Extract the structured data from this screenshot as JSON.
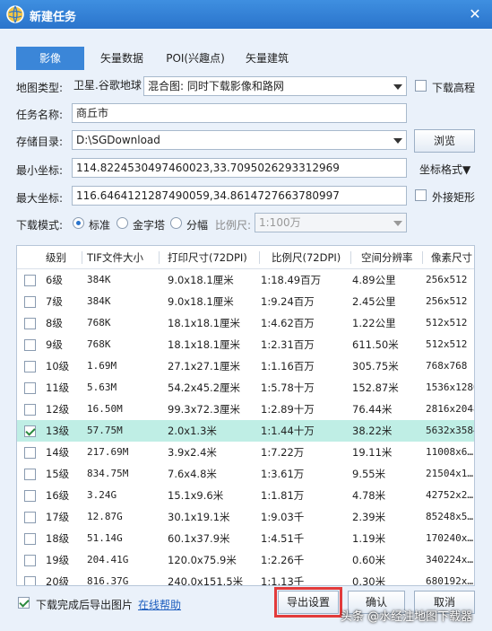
{
  "window": {
    "title": "新建任务",
    "close": "✕"
  },
  "tabs": [
    {
      "label": "影像",
      "active": true
    },
    {
      "label": "矢量数据",
      "active": false
    },
    {
      "label": "POI(兴趣点)",
      "active": false
    },
    {
      "label": "矢量建筑",
      "active": false
    }
  ],
  "form": {
    "map_type_label": "地图类型:",
    "map_type_source": "卫星.谷歌地球",
    "map_type_value": "混合图: 同时下载影像和路网",
    "download_elevation_label": "下载高程",
    "task_name_label": "任务名称:",
    "task_name_value": "商丘市",
    "storage_dir_label": "存储目录:",
    "storage_dir_value": "D:\\SGDownload",
    "browse_label": "浏览",
    "min_coord_label": "最小坐标:",
    "min_coord_value": "114.8224530497460023,33.7095026293312969",
    "coord_format_label": "坐标格式▼",
    "max_coord_label": "最大坐标:",
    "max_coord_value": "116.6464121287490059,34.8614727663780997",
    "bounding_rect_label": "外接矩形",
    "download_mode_label": "下载模式:",
    "mode_standard": "标准",
    "mode_pyramid": "金字塔",
    "mode_split": "分幅",
    "scale_label": "比例尺:",
    "scale_value": "1:100万"
  },
  "table": {
    "headers": [
      "级别",
      "TIF文件大小",
      "打印尺寸(72DPI)",
      "比例尺(72DPI)",
      "空间分辨率",
      "像素尺寸"
    ],
    "rows": [
      {
        "checked": false,
        "level": "6级",
        "size": "384K",
        "print": "9.0x18.1厘米",
        "scale": "1:18.49百万",
        "res": "4.89公里",
        "pixels": "256x512"
      },
      {
        "checked": false,
        "level": "7级",
        "size": "384K",
        "print": "9.0x18.1厘米",
        "scale": "1:9.24百万",
        "res": "2.45公里",
        "pixels": "256x512"
      },
      {
        "checked": false,
        "level": "8级",
        "size": "768K",
        "print": "18.1x18.1厘米",
        "scale": "1:4.62百万",
        "res": "1.22公里",
        "pixels": "512x512"
      },
      {
        "checked": false,
        "level": "9级",
        "size": "768K",
        "print": "18.1x18.1厘米",
        "scale": "1:2.31百万",
        "res": "611.50米",
        "pixels": "512x512"
      },
      {
        "checked": false,
        "level": "10级",
        "size": "1.69M",
        "print": "27.1x27.1厘米",
        "scale": "1:1.16百万",
        "res": "305.75米",
        "pixels": "768x768"
      },
      {
        "checked": false,
        "level": "11级",
        "size": "5.63M",
        "print": "54.2x45.2厘米",
        "scale": "1:5.78十万",
        "res": "152.87米",
        "pixels": "1536x1280"
      },
      {
        "checked": false,
        "level": "12级",
        "size": "16.50M",
        "print": "99.3x72.3厘米",
        "scale": "1:2.89十万",
        "res": "76.44米",
        "pixels": "2816x2048"
      },
      {
        "checked": true,
        "level": "13级",
        "size": "57.75M",
        "print": "2.0x1.3米",
        "scale": "1:1.44十万",
        "res": "38.22米",
        "pixels": "5632x3584"
      },
      {
        "checked": false,
        "level": "14级",
        "size": "217.69M",
        "print": "3.9x2.4米",
        "scale": "1:7.22万",
        "res": "19.11米",
        "pixels": "11008x6…"
      },
      {
        "checked": false,
        "level": "15级",
        "size": "834.75M",
        "print": "7.6x4.8米",
        "scale": "1:3.61万",
        "res": "9.55米",
        "pixels": "21504x1…"
      },
      {
        "checked": false,
        "level": "16级",
        "size": "3.24G",
        "print": "15.1x9.6米",
        "scale": "1:1.81万",
        "res": "4.78米",
        "pixels": "42752x2…"
      },
      {
        "checked": false,
        "level": "17级",
        "size": "12.87G",
        "print": "30.1x19.1米",
        "scale": "1:9.03千",
        "res": "2.39米",
        "pixels": "85248x5…"
      },
      {
        "checked": false,
        "level": "18级",
        "size": "51.14G",
        "print": "60.1x37.9米",
        "scale": "1:4.51千",
        "res": "1.19米",
        "pixels": "170240x…"
      },
      {
        "checked": false,
        "level": "19级",
        "size": "204.41G",
        "print": "120.0x75.9米",
        "scale": "1:2.26千",
        "res": "0.60米",
        "pixels": "340224x…"
      },
      {
        "checked": false,
        "level": "20级",
        "size": "816.37G",
        "print": "240.0x151.5米",
        "scale": "1:1.13千",
        "res": "0.30米",
        "pixels": "680192x…"
      }
    ]
  },
  "footer": {
    "export_after_label": "下载完成后导出图片",
    "online_help": "在线帮助",
    "export_settings": "导出设置",
    "ok": "确认",
    "cancel": "取消"
  },
  "watermark": "头条 @水经注地图下载器",
  "colors": {
    "titlebar": "#2a74cc",
    "active_tab": "#3b86d8",
    "selected_row": "#bfeee5",
    "highlight": "#e23b3b",
    "link": "#1f5fbf"
  }
}
